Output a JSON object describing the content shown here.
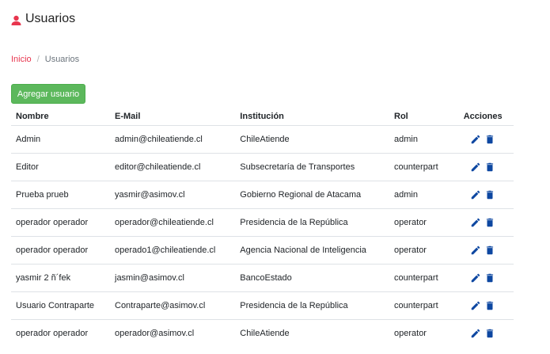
{
  "page": {
    "title": "Usuarios",
    "icon": "person-icon"
  },
  "breadcrumb": {
    "home_label": "Inicio",
    "separator": "/",
    "current_label": "Usuarios"
  },
  "toolbar": {
    "add_user_label": "Agregar usuario"
  },
  "colors": {
    "accent_red": "#e8364f",
    "button_green": "#5cb85c",
    "action_blue": "#0d47a1"
  },
  "table": {
    "columns": [
      "Nombre",
      "E-Mail",
      "Institución",
      "Rol",
      "Acciones"
    ],
    "row_action_icons": [
      "edit-icon",
      "delete-icon"
    ],
    "rows": [
      {
        "name": "Admin",
        "email": "admin@chileatiende.cl",
        "institution": "ChileAtiende",
        "role": "admin"
      },
      {
        "name": "Editor",
        "email": "editor@chileatiende.cl",
        "institution": "Subsecretaría de Transportes",
        "role": "counterpart"
      },
      {
        "name": "Prueba prueb",
        "email": "yasmir@asimov.cl",
        "institution": "Gobierno Regional de Atacama",
        "role": "admin"
      },
      {
        "name": "operador operador",
        "email": "operador@chileatiende.cl",
        "institution": "Presidencia de la República",
        "role": "operator"
      },
      {
        "name": "operador operador",
        "email": "operado1@chileatiende.cl",
        "institution": "Agencia Nacional de Inteligencia",
        "role": "operator"
      },
      {
        "name": "yasmir 2 ñ´fek",
        "email": "jasmin@asimov.cl",
        "institution": "BancoEstado",
        "role": "counterpart"
      },
      {
        "name": "Usuario Contraparte",
        "email": "Contraparte@asimov.cl",
        "institution": "Presidencia de la República",
        "role": "counterpart"
      },
      {
        "name": "operador operador",
        "email": "operador@asimov.cl",
        "institution": "ChileAtiende",
        "role": "operator"
      }
    ]
  }
}
